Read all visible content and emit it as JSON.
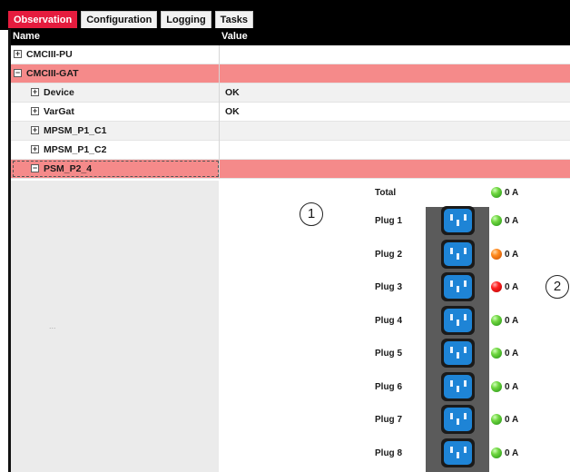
{
  "tabs": [
    {
      "label": "Observation",
      "active": true
    },
    {
      "label": "Configuration",
      "active": false
    },
    {
      "label": "Logging",
      "active": false
    },
    {
      "label": "Tasks",
      "active": false
    }
  ],
  "columns": {
    "name": "Name",
    "value": "Value"
  },
  "tree": [
    {
      "name": "CMCIII-PU",
      "value": "",
      "expander": "+",
      "indent": 0,
      "style": "white"
    },
    {
      "name": "CMCIII-GAT",
      "value": "",
      "expander": "−",
      "indent": 0,
      "style": "red"
    },
    {
      "name": "Device",
      "value": "OK",
      "expander": "+",
      "indent": 1,
      "style": "grey"
    },
    {
      "name": "VarGat",
      "value": "OK",
      "expander": "+",
      "indent": 1,
      "style": "white"
    },
    {
      "name": "MPSM_P1_C1",
      "value": "",
      "expander": "+",
      "indent": 1,
      "style": "grey"
    },
    {
      "name": "MPSM_P1_C2",
      "value": "",
      "expander": "+",
      "indent": 1,
      "style": "white"
    },
    {
      "name": "PSM_P2_4",
      "value": "",
      "expander": "−",
      "indent": 1,
      "style": "red",
      "selected": true
    }
  ],
  "ellipsis": "...",
  "psm": {
    "total": {
      "label": "Total",
      "status": "green",
      "current": "0 A"
    },
    "plugs": [
      {
        "label": "Plug 1",
        "status": "green",
        "current": "0 A"
      },
      {
        "label": "Plug 2",
        "status": "orange",
        "current": "0 A"
      },
      {
        "label": "Plug 3",
        "status": "red",
        "current": "0 A"
      },
      {
        "label": "Plug 4",
        "status": "green",
        "current": "0 A"
      },
      {
        "label": "Plug 5",
        "status": "green",
        "current": "0 A"
      },
      {
        "label": "Plug 6",
        "status": "green",
        "current": "0 A"
      },
      {
        "label": "Plug 7",
        "status": "green",
        "current": "0 A"
      },
      {
        "label": "Plug 8",
        "status": "green",
        "current": "0 A"
      }
    ]
  },
  "callouts": [
    "1",
    "2"
  ],
  "colors": {
    "accent": "#e51c3e",
    "row_highlight": "#f58a8a",
    "socket": "#1e84d6"
  }
}
